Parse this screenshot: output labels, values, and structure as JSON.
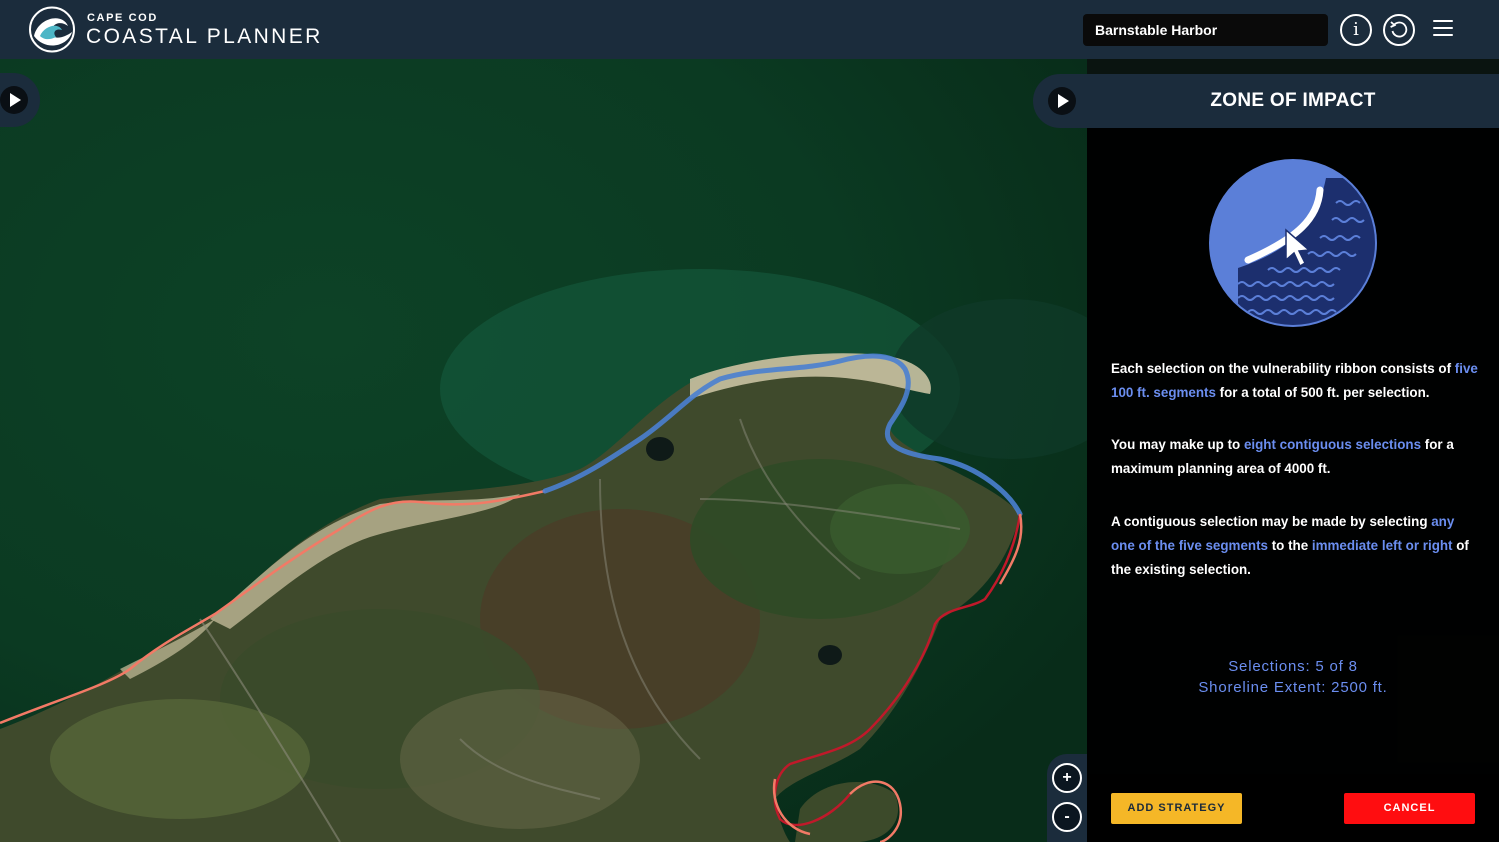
{
  "header": {
    "brand_top": "CAPE COD",
    "brand_main": "COASTAL PLANNER",
    "location": "Barnstable Harbor",
    "info_label": "i"
  },
  "panel": {
    "title": "ZONE OF IMPACT",
    "p1": {
      "t1": "Each selection on the vulnerability ribbon consists of ",
      "h1": "five 100 ft. segments",
      "t2": " for a total of 500 ft. per selection."
    },
    "p2": {
      "t1": "You may make up to ",
      "h1": "eight contiguous selections",
      "t2": " for a maximum planning area of 4000 ft."
    },
    "p3": {
      "t1": "A contiguous selection may be made by selecting ",
      "h1": "any one of the five segments",
      "t2": " to the ",
      "h2": "immediate left or right",
      "t3": " of the existing selection."
    },
    "selections": "Selections: 5 of 8",
    "extent": "Shoreline Extent: 2500 ft.",
    "add_strategy": "ADD STRATEGY",
    "cancel": "CANCEL"
  },
  "map": {
    "zoom_in": "+",
    "zoom_out": "-"
  },
  "colors": {
    "header_bg": "#1b2c3c",
    "accent_blue": "#6b8ef0",
    "selected_ribbon": "#4a7fd0",
    "vulnerable_ribbon": "#f27a66",
    "high_vulnerable_ribbon": "#c0192a",
    "add_button": "#f5b727",
    "cancel_button": "#ff0d10"
  }
}
